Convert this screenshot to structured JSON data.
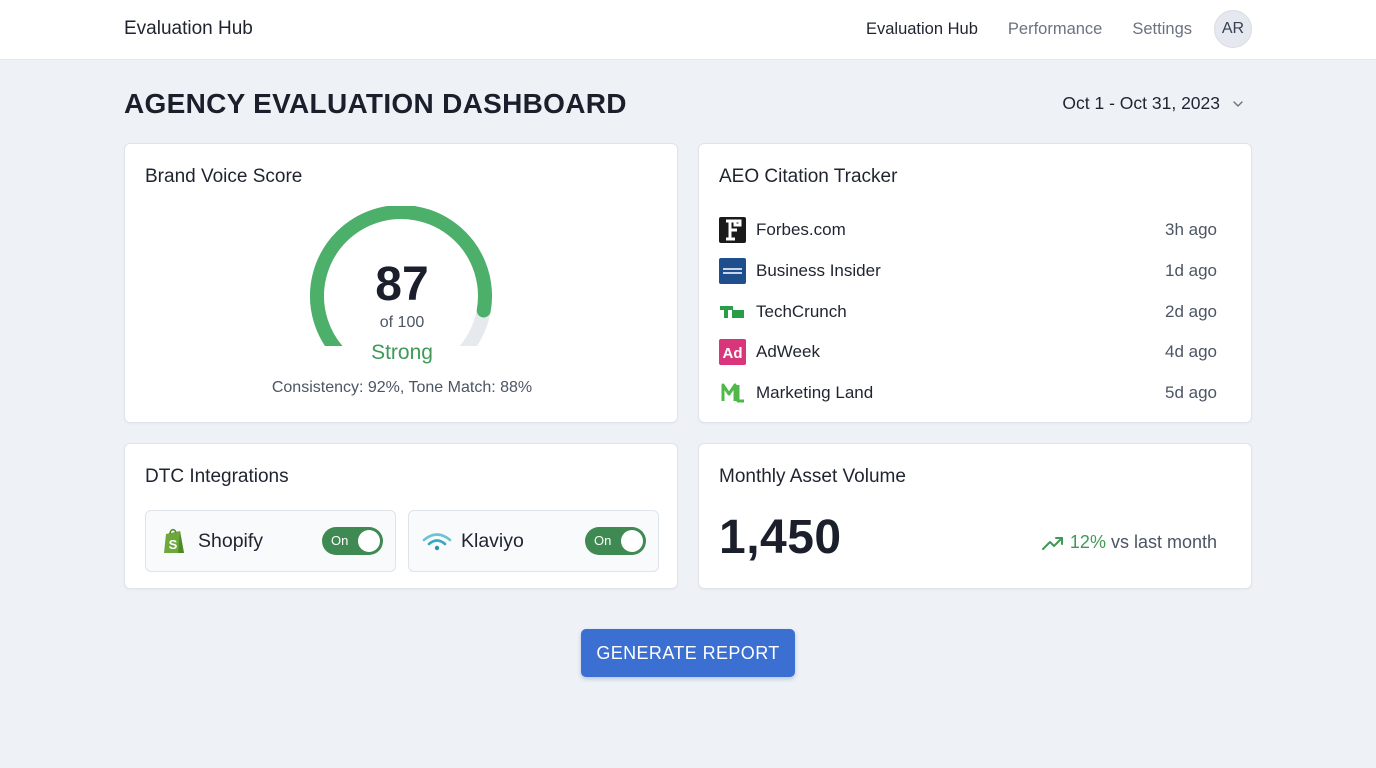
{
  "header": {
    "brand": "Evaluation Hub",
    "nav": [
      "Evaluation Hub",
      "Performance",
      "Settings"
    ],
    "avatar_initials": "AR"
  },
  "page": {
    "title": "AGENCY EVALUATION DASHBOARD",
    "date_range": "Oct 1 - Oct 31, 2023"
  },
  "brand_voice": {
    "title": "Brand Voice Score",
    "score": "87",
    "score_value": 87,
    "max_label": "of 100",
    "max_value": 100,
    "rating": "Strong",
    "detail": "Consistency: 92%, Tone Match: 88%",
    "colors": {
      "accent": "#4caf6a",
      "track": "#e6e9ee"
    }
  },
  "aeo": {
    "title": "AEO Citation Tracker",
    "citations": [
      {
        "name": "Forbes.com",
        "time": "3h ago",
        "icon": "forbes-logo-icon"
      },
      {
        "name": "Business Insider",
        "time": "1d ago",
        "icon": "business-insider-logo-icon"
      },
      {
        "name": "TechCrunch",
        "time": "2d ago",
        "icon": "techcrunch-logo-icon"
      },
      {
        "name": "AdWeek",
        "time": "4d ago",
        "icon": "adweek-logo-icon"
      },
      {
        "name": "Marketing Land",
        "time": "5d ago",
        "icon": "marketing-land-logo-icon"
      }
    ]
  },
  "dtc": {
    "title": "DTC Integrations",
    "integrations": [
      {
        "name": "Shopify",
        "state": "On",
        "icon": "shopify-logo-icon"
      },
      {
        "name": "Klaviyo",
        "state": "On",
        "icon": "klaviyo-logo-icon"
      }
    ]
  },
  "volume": {
    "title": "Monthly Asset Volume",
    "value": "1,450",
    "trend_pct": "12%",
    "trend_text": "vs last month",
    "trend_icon": "trending-up-icon"
  },
  "actions": {
    "generate_label": "GENERATE REPORT"
  },
  "colors": {
    "primary": "#3b6fd1",
    "success": "#3f9a56",
    "toggle_on": "#3f8a52"
  }
}
